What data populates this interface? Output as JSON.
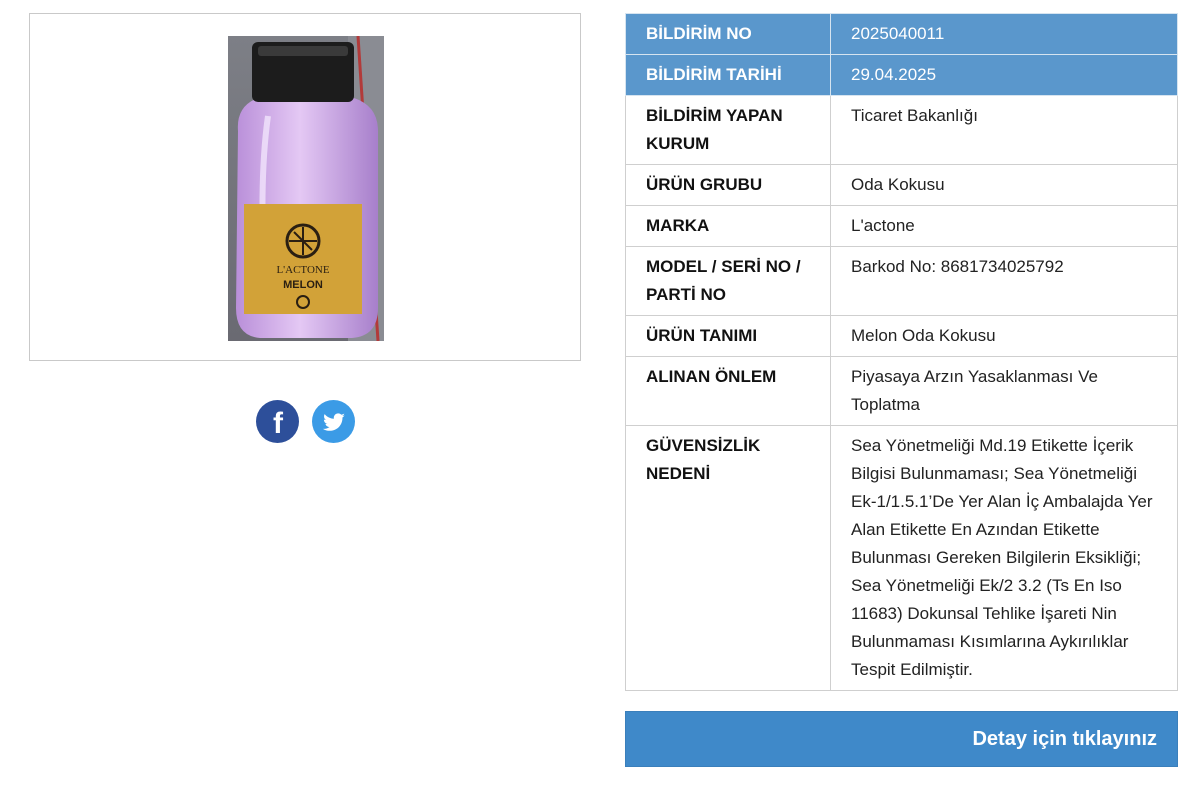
{
  "product_image": {
    "label_brand": "L'ACTONE",
    "label_variant": "MELON"
  },
  "social": {
    "facebook_glyph": "f",
    "twitter_icon": "twitter-bird-icon"
  },
  "details": [
    {
      "key": "BİLDİRİM NO",
      "value": "2025040011",
      "highlight": true
    },
    {
      "key": "BİLDİRİM TARİHİ",
      "value": "29.04.2025",
      "highlight": true
    },
    {
      "key": "BİLDİRİM YAPAN KURUM",
      "value": "Ticaret Bakanlığı",
      "highlight": false
    },
    {
      "key": "ÜRÜN GRUBU",
      "value": "Oda Kokusu",
      "highlight": false
    },
    {
      "key": "MARKA",
      "value": "L'actone",
      "highlight": false
    },
    {
      "key": "MODEL / SERİ NO / PARTİ NO",
      "value": "Barkod No: 8681734025792",
      "highlight": false
    },
    {
      "key": "ÜRÜN TANIMI",
      "value": "Melon Oda Kokusu",
      "highlight": false
    },
    {
      "key": "ALINAN ÖNLEM",
      "value": "Piyasaya Arzın Yasaklanması Ve Toplatma",
      "highlight": false
    },
    {
      "key": "GÜVENSİZLİK NEDENİ",
      "value": "Sea Yönetmeliği Md.19 Etikette İçerik Bilgisi Bulunmaması; Sea Yönetmeliği Ek-1/1.5.1’De Yer Alan İç Ambalajda Yer Alan Etikette En Azından Etikette Bulunması Gereken Bilgilerin Eksikliği; Sea Yönetmeliği Ek/2 3.2 (Ts En Iso 11683) Dokunsal Tehlike İşareti Nin Bulunmaması Kısımlarına Aykırılıklar Tespit Edilmiştir.",
      "highlight": false
    }
  ],
  "detail_button": {
    "label": "Detay için tıklayınız"
  },
  "colors": {
    "header_blue": "#5a97cc",
    "button_blue": "#3f89c9",
    "facebook": "#2d4f9a",
    "twitter": "#3b9be6"
  }
}
